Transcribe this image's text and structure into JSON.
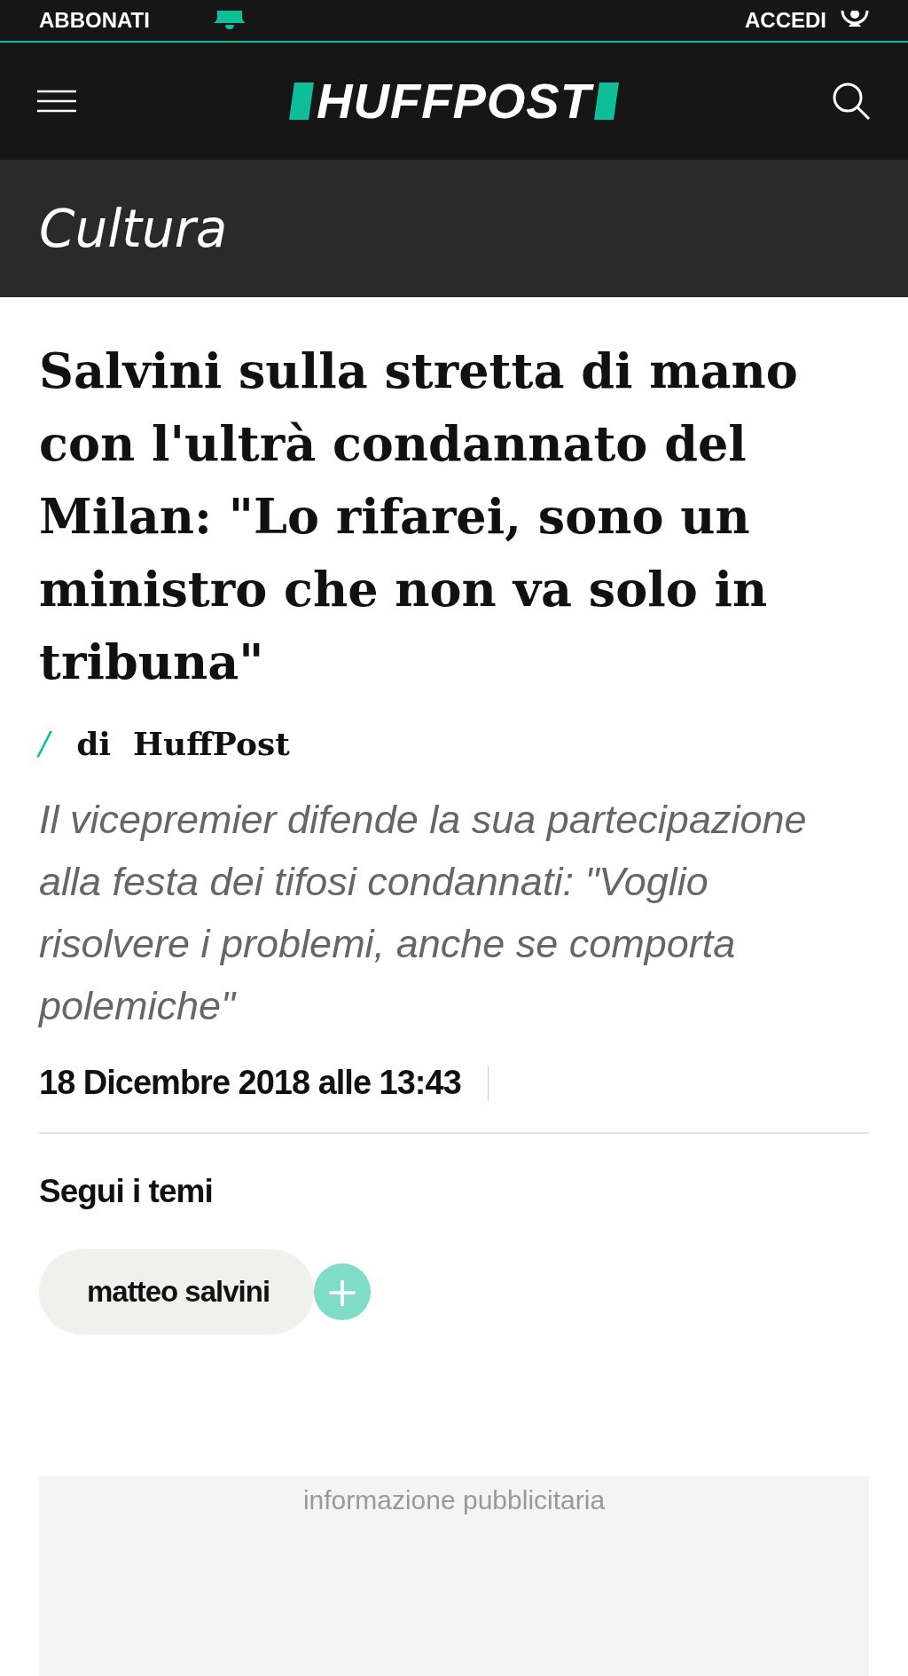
{
  "top_bar": {
    "subscribe": "ABBONATI",
    "login": "ACCEDI"
  },
  "header": {
    "logo": "HUFFPOST"
  },
  "section": {
    "title": "Cultura"
  },
  "article": {
    "headline": "Salvini sulla stretta di mano con l'ultrà condannato del Milan: \"Lo rifarei, sono un ministro che non va solo in tribuna\"",
    "byline_prefix": "/",
    "byline": "di  HuffPost",
    "subtitle": "Il vicepremier difende la sua partecipazione alla festa dei tifosi condannati: \"Voglio risolvere i problemi, anche se comporta polemiche\"",
    "date": "18 Dicembre 2018 alle 13:43"
  },
  "topics": {
    "title": "Segui i temi",
    "tags": [
      {
        "label": "matteo salvini",
        "action": "+"
      }
    ]
  },
  "ad": {
    "label": "informazione pubblicitaria"
  }
}
